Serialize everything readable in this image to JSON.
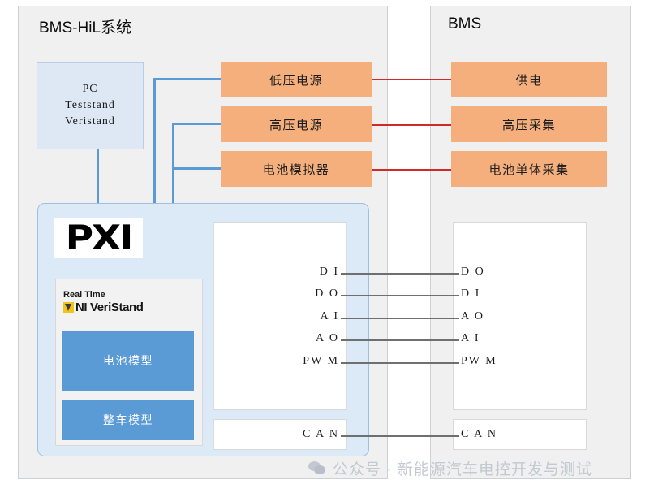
{
  "left_panel": {
    "title": "BMS-HiL系统"
  },
  "right_panel": {
    "title": "BMS"
  },
  "pc_box": {
    "line1": "PC",
    "line2": "Teststand",
    "line3": "Veristand"
  },
  "hil_blocks": [
    {
      "label": "低压电源"
    },
    {
      "label": "高压电源"
    },
    {
      "label": "电池模拟器"
    }
  ],
  "bms_blocks": [
    {
      "label": "供电"
    },
    {
      "label": "高压采集"
    },
    {
      "label": "电池单体采集"
    }
  ],
  "pxi": {
    "logo_text": "PXI",
    "realtime_label": "Real Time",
    "veristand_label": "NI VeriStand",
    "models": [
      {
        "label": "电池模型"
      },
      {
        "label": "整车模型"
      }
    ]
  },
  "io_signals": {
    "left": [
      "D I",
      "D O",
      "A I",
      "A O",
      "PW M"
    ],
    "right": [
      "D O",
      "D I",
      "A O",
      "A I",
      "PW M"
    ]
  },
  "can": {
    "left_label": "C A N",
    "right_label": "C A N"
  },
  "watermark": {
    "icon": "wechat-icon",
    "text": "公众号 · 新能源汽车电控开发与测试"
  },
  "colors": {
    "orange": "#f4af7d",
    "blue_box": "#5b9bd5",
    "light_blue": "#dee8f5",
    "pxi_bg": "#dce9f7",
    "panel_bg": "#f0f0f0",
    "red_line": "#cf2a27",
    "blue_line": "#5b9bd5",
    "grey_line": "#6f6f6f"
  }
}
